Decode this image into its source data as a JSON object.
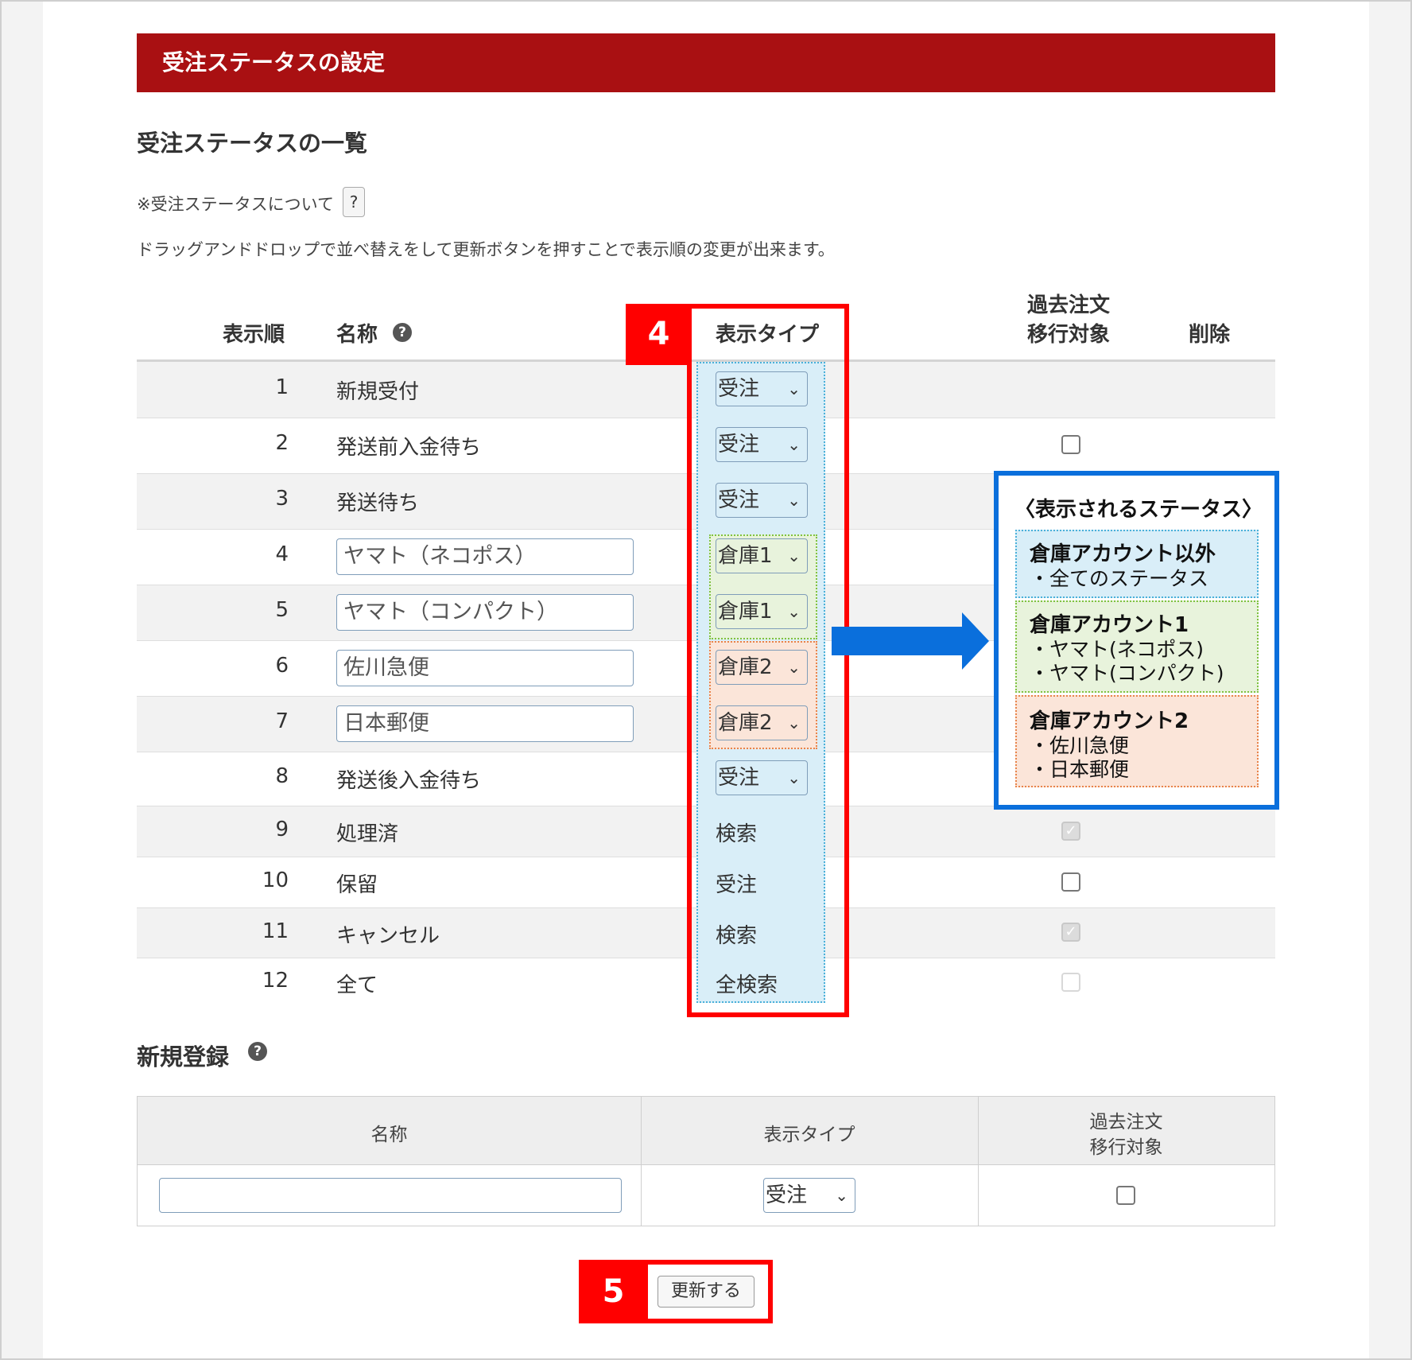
{
  "header": {
    "title": "受注ステータスの設定"
  },
  "list_section": {
    "title": "受注ステータスの一覧",
    "note": "※受注ステータスについて",
    "help_label": "?",
    "description": "ドラッグアンドドロップで並べ替えをして更新ボタンを押すことで表示順の変更が出来ます。"
  },
  "table": {
    "headers": {
      "order": "表示順",
      "name": "名称",
      "type": "表示タイプ",
      "migrate_line1": "過去注文",
      "migrate_line2": "移行対象",
      "delete": "削除"
    },
    "rows": [
      {
        "order": "1",
        "name": "新規受付",
        "type": "受注"
      },
      {
        "order": "2",
        "name": "発送前入金待ち",
        "type": "受注"
      },
      {
        "order": "3",
        "name": "発送待ち",
        "type": "受注"
      },
      {
        "order": "4",
        "name": "ヤマト（ネコポス）",
        "type": "倉庫1"
      },
      {
        "order": "5",
        "name": "ヤマト（コンパクト）",
        "type": "倉庫1"
      },
      {
        "order": "6",
        "name": "佐川急便",
        "type": "倉庫2"
      },
      {
        "order": "7",
        "name": "日本郵便",
        "type": "倉庫2"
      },
      {
        "order": "8",
        "name": "発送後入金待ち",
        "type": "受注"
      },
      {
        "order": "9",
        "name": "処理済",
        "type": "検索"
      },
      {
        "order": "10",
        "name": "保留",
        "type": "受注"
      },
      {
        "order": "11",
        "name": "キャンセル",
        "type": "検索"
      },
      {
        "order": "12",
        "name": "全て",
        "type": "全検索"
      }
    ]
  },
  "annotations": {
    "step4": "4",
    "step5": "5"
  },
  "callout": {
    "title": "〈表示されるステータス〉",
    "groups": [
      {
        "title": "倉庫アカウント以外",
        "items": [
          "・全てのステータス"
        ],
        "color": "#d9eef8"
      },
      {
        "title": "倉庫アカウント1",
        "items": [
          "・ヤマト(ネコポス)",
          "・ヤマト(コンパクト)"
        ],
        "color": "#e8f3dc"
      },
      {
        "title": "倉庫アカウント2",
        "items": [
          "・佐川急便",
          "・日本郵便"
        ],
        "color": "#fbe5d9"
      }
    ]
  },
  "register": {
    "title": "新規登録",
    "headers": {
      "name": "名称",
      "type": "表示タイプ",
      "migrate_line1": "過去注文",
      "migrate_line2": "移行対象"
    },
    "name_value": "",
    "type_value": "受注"
  },
  "update_button": {
    "label": "更新する"
  },
  "colors": {
    "header_bg": "#a91012",
    "annotation_red": "#ff0000",
    "callout_blue": "#0a6fdc",
    "type_column_bg": "#d9eef8",
    "warehouse1_bg": "#e8f3dc",
    "warehouse2_bg": "#fbe5d9"
  }
}
